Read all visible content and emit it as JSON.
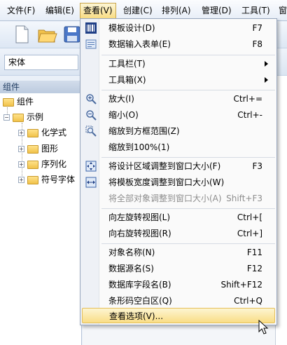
{
  "menubar": {
    "items": [
      {
        "label": "文件(F)"
      },
      {
        "label": "编辑(E)"
      },
      {
        "label": "查看(V)"
      },
      {
        "label": "创建(C)"
      },
      {
        "label": "排列(A)"
      },
      {
        "label": "管理(D)"
      },
      {
        "label": "工具(T)"
      },
      {
        "label": "窗"
      }
    ]
  },
  "toolbar2": {
    "font": "宋体"
  },
  "panel": {
    "title": "组件",
    "tree": {
      "root": "组件",
      "examples": "示例",
      "items": [
        "化学式",
        "图形",
        "序列化",
        "符号字体"
      ]
    }
  },
  "view_menu": {
    "items": [
      {
        "label": "模板设计(D)",
        "accel": "F7"
      },
      {
        "label": "数据输入表单(E)",
        "accel": "F8"
      },
      {
        "label": "工具栏(T)",
        "accel": ""
      },
      {
        "label": "工具箱(X)",
        "accel": ""
      },
      {
        "label": "放大(I)",
        "accel": "Ctrl+="
      },
      {
        "label": "缩小(O)",
        "accel": "Ctrl+-"
      },
      {
        "label": "缩放到方框范围(Z)",
        "accel": ""
      },
      {
        "label": "缩放到100%(1)",
        "accel": ""
      },
      {
        "label": "将设计区域调整到窗口大小(F)",
        "accel": "F3"
      },
      {
        "label": "将模板宽度调整到窗口大小(W)",
        "accel": ""
      },
      {
        "label": "将全部对象调整到窗口大小(A)",
        "accel": "Shift+F3"
      },
      {
        "label": "向左旋转视图(L)",
        "accel": "Ctrl+["
      },
      {
        "label": "向右旋转视图(R)",
        "accel": "Ctrl+]"
      },
      {
        "label": "对象名称(N)",
        "accel": "F11"
      },
      {
        "label": "数据源名(S)",
        "accel": "F12"
      },
      {
        "label": "数据库字段名(B)",
        "accel": "Shift+F12"
      },
      {
        "label": "条形码空白区(Q)",
        "accel": "Ctrl+Q"
      },
      {
        "label": "查看选项(V)...",
        "accel": ""
      }
    ]
  },
  "colors": {
    "highlight": "#f9dd86",
    "menu_active": "#f8dc83",
    "disabled_text": "#8d8d8d"
  }
}
